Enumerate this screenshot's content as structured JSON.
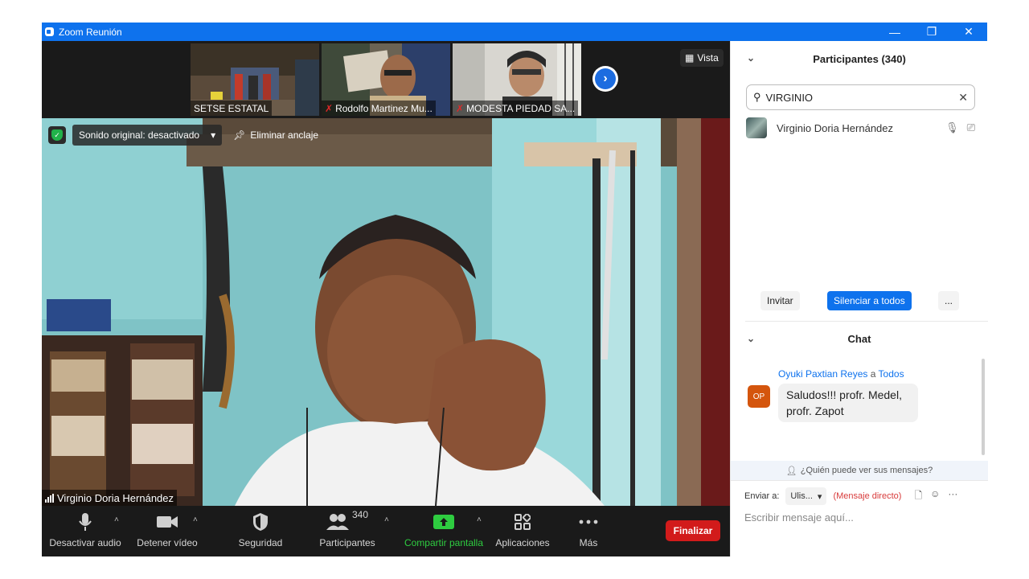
{
  "window": {
    "title": "Zoom Reunión",
    "minimize_glyph": "—",
    "restore_glyph": "❐",
    "close_glyph": "✕"
  },
  "thumbnails": [
    {
      "name": "SETSE ESTATAL",
      "muted": false
    },
    {
      "name": "Rodolfo Martinez Mu...",
      "muted": true
    },
    {
      "name": "MODESTA PIEDAD SA...",
      "muted": true
    }
  ],
  "view_button": {
    "label": "Vista",
    "icon": "grid-icon"
  },
  "main_video": {
    "sound_label": "Sonido original: desactivado",
    "unpin_label": "Eliminar anclaje",
    "speaker_name": "Virginio Doria Hernández"
  },
  "toolbar": {
    "audio_label": "Desactivar audio",
    "video_label": "Detener vídeo",
    "security_label": "Seguridad",
    "participants_label": "Participantes",
    "participants_count": "340",
    "share_label": "Compartir pantalla",
    "apps_label": "Aplicaciones",
    "more_label": "Más",
    "end_label": "Finalizar"
  },
  "participants_panel": {
    "title": "Participantes (340)",
    "search_value": "VIRGINIO",
    "participant_name": "Virginio Doria Hernández",
    "invite_label": "Invitar",
    "mute_all_label": "Silenciar a todos",
    "more_label": "..."
  },
  "chat_panel": {
    "title": "Chat",
    "sender": "Oyuki Paxtian Reyes",
    "connector": "a",
    "target": "Todos",
    "avatar_initials": "OP",
    "message": "Saludos!!! profr. Medel, profr. Zapot",
    "who_can_see": "¿Quién puede ver sus mensajes?",
    "send_to_label": "Enviar a:",
    "recipient": "Ulis...",
    "direct_message_label": "(Mensaje directo)",
    "input_placeholder": "Escribir mensaje aquí..."
  },
  "colors": {
    "accent": "#0e72ed",
    "end_button": "#d21b1b",
    "share_green": "#2ecc40",
    "toolbar_bg": "#1a1a1a"
  }
}
